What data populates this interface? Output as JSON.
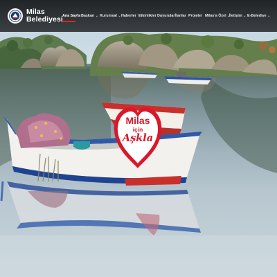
{
  "site": {
    "logo_line1": "Milas",
    "logo_line2": "Belediyesi",
    "logo_icon": "municipality-emblem-icon"
  },
  "nav": {
    "items": [
      {
        "label": "Ana Sayfa",
        "dropdown": false,
        "active": true
      },
      {
        "label": "Başkan",
        "dropdown": true,
        "active": false
      },
      {
        "label": "Kurumsal",
        "dropdown": true,
        "active": false
      },
      {
        "label": "Haberler",
        "dropdown": false,
        "active": false
      },
      {
        "label": "Etkinlikler",
        "dropdown": false,
        "active": false
      },
      {
        "label": "Duyurular",
        "dropdown": false,
        "active": false
      },
      {
        "label": "İlanlar",
        "dropdown": false,
        "active": false
      },
      {
        "label": "Projeler",
        "dropdown": false,
        "active": false
      },
      {
        "label": "Milas'a Özel",
        "dropdown": true,
        "active": false
      },
      {
        "label": "İletişim",
        "dropdown": true,
        "active": false
      },
      {
        "label": "E-Belediye",
        "dropdown": true,
        "active": false
      }
    ],
    "dropdown_icon": "chevron-down-icon"
  },
  "hero": {
    "badge_line1": "Milas",
    "badge_line2": "için",
    "badge_line3": "Aşkla",
    "badge_icon": "heart-icon"
  },
  "colors": {
    "header_bg": "#1c1e20",
    "accent": "#e0251b",
    "badge_red": "#d7192a",
    "nav_text": "#e8e8e8"
  }
}
